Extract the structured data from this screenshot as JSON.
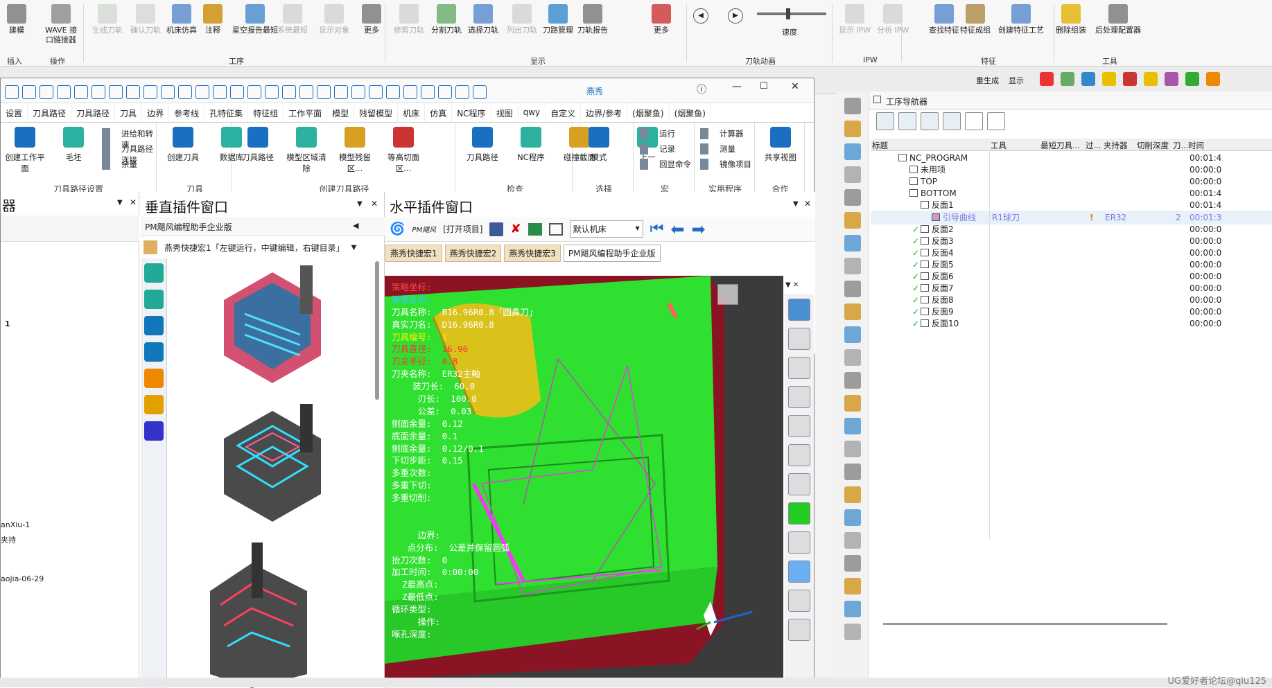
{
  "ribbon": {
    "buttons": [
      {
        "label": "建模",
        "icon": "modeling-icon"
      },
      {
        "label": "WAVE 接\n口链接器",
        "icon": "wave-link-icon"
      },
      {
        "label": "生成刀轨",
        "icon": "generate-path-icon",
        "disabled": true
      },
      {
        "label": "确认刀轨",
        "icon": "verify-path-icon",
        "disabled": true
      },
      {
        "label": "机床仿真",
        "icon": "machine-sim-icon"
      },
      {
        "label": "注释",
        "icon": "annotation-icon"
      },
      {
        "label": "星空报告最短",
        "icon": "report-icon"
      },
      {
        "label": "系统最短",
        "icon": "system-short-icon",
        "disabled": true
      },
      {
        "label": "显示对象",
        "icon": "show-object-icon",
        "disabled": true
      },
      {
        "label": "更多",
        "icon": "more-icon"
      },
      {
        "label": "修剪刀轨",
        "icon": "trim-path-icon",
        "disabled": true
      },
      {
        "label": "分割刀轨",
        "icon": "split-path-icon"
      },
      {
        "label": "选择刀轨",
        "icon": "select-path-icon"
      },
      {
        "label": "列出刀轨",
        "icon": "list-path-icon",
        "disabled": true
      },
      {
        "label": "刀路管理",
        "icon": "path-manage-icon"
      },
      {
        "label": "刀轨报告",
        "icon": "path-report-icon"
      },
      {
        "label": "更多",
        "icon": "more-icon"
      },
      {
        "label": "显示 IPW",
        "icon": "show-ipw-icon",
        "disabled": true
      },
      {
        "label": "分析 IPW",
        "icon": "analyze-ipw-icon",
        "disabled": true
      },
      {
        "label": "查找特征",
        "icon": "find-feature-icon"
      },
      {
        "label": "特征成组",
        "icon": "feature-group-icon"
      },
      {
        "label": "创建特征工艺",
        "icon": "feature-process-icon"
      },
      {
        "label": "删除组装",
        "icon": "delete-assembly-icon"
      },
      {
        "label": "后处理配置器",
        "icon": "postprocessor-icon"
      }
    ],
    "groups": [
      "插入",
      "操作",
      "工序",
      "显示",
      "刀轨动画",
      "IPW",
      "特征",
      "工具"
    ],
    "speed_label": "速度"
  },
  "subwin": {
    "title": "燕秀",
    "tabs": [
      "设置",
      "刀具路径",
      "刀具路径",
      "刀具",
      "边界",
      "参考线",
      "孔特征集",
      "特征组",
      "工作平面",
      "模型",
      "残留模型",
      "机床",
      "仿真",
      "NC程序",
      "视图",
      "qwy",
      "自定义",
      "边界/参考",
      "(烟聚鱼)",
      "(烟聚鱼)"
    ],
    "groups": [
      {
        "label": "刀具路径设置",
        "buttons": [
          "创建工作平面",
          "毛坯"
        ],
        "small": [
          "进给和转速",
          "刀具路径连接",
          "余量"
        ]
      },
      {
        "label": "刀具",
        "buttons": [
          "创建刀具",
          "数据库"
        ]
      },
      {
        "label": "创建刀具路径",
        "buttons": [
          "刀具路径",
          "模型区域清除",
          "模型残留区...",
          "等高切面区..."
        ]
      },
      {
        "label": "检查",
        "buttons": [
          "刀具路径",
          "NC程序",
          "碰撞截面"
        ]
      },
      {
        "label": "选择",
        "buttons": [
          "模式",
          "上一"
        ]
      },
      {
        "label": "宏",
        "small": [
          "运行",
          "记录",
          "回显命令"
        ]
      },
      {
        "label": "实用程序",
        "small": [
          "计算器",
          "测量",
          "镜像项目"
        ]
      },
      {
        "label": "合作",
        "buttons": [
          "共享视图"
        ]
      }
    ]
  },
  "left_pane": {
    "labels": [
      "1",
      "anXiu-1",
      "夹持",
      "aojia-06-29"
    ]
  },
  "vpane": {
    "title": "垂直插件窗口",
    "sub": "PM飓风编程助手企业版",
    "macro": "燕秀快捷宏1「左键运行，中键编辑，右键目录」"
  },
  "hpane": {
    "title": "水平插件窗口",
    "toolbar": {
      "logo": "PM飓风",
      "open": "[打开项目]",
      "machine": "默认机床"
    },
    "macros": [
      "燕秀快捷宏1",
      "燕秀快捷宏2",
      "燕秀快捷宏3"
    ],
    "active_tab": "PM飓风编程助手企业版"
  },
  "info_lines": [
    {
      "t": "策略坐标:",
      "c": "#ff4444"
    },
    {
      "t": "策略名称:",
      "c": "#33ccff"
    },
    {
      "t": "刀具名称:  B16.96R0.8「圆鼻刀」",
      "c": "#ffffff"
    },
    {
      "t": "真实刀名:  D16.96R0.8",
      "c": "#ffffff"
    },
    {
      "t": "刀具编号:  1",
      "c": "#ffee00"
    },
    {
      "t": "刀具直径:  16.96",
      "c": "#ff3333"
    },
    {
      "t": "刀尖半径:  0.8",
      "c": "#ff3333"
    },
    {
      "t": "刀夹名称:  ER32主軸",
      "c": "#ffffff"
    },
    {
      "t": "    装刀长:  60.0",
      "c": "#ffffff"
    },
    {
      "t": "     刃长:  100.0",
      "c": "#ffffff"
    },
    {
      "t": "     公差:  0.03",
      "c": "#ffffff"
    },
    {
      "t": "侧面余量:  0.12",
      "c": "#ffffff"
    },
    {
      "t": "底面余量:  0.1",
      "c": "#ffffff"
    },
    {
      "t": "侧底余量:  0.12/0.1",
      "c": "#ffffff"
    },
    {
      "t": "下切步距:  0.15",
      "c": "#ffffff"
    },
    {
      "t": "多重次数:",
      "c": "#ffffff"
    },
    {
      "t": "多重下切:",
      "c": "#ffffff"
    },
    {
      "t": "多重切削:",
      "c": "#ffffff"
    },
    {
      "t": "",
      "c": "#ffffff"
    },
    {
      "t": "",
      "c": "#ffffff"
    },
    {
      "t": "     边界:",
      "c": "#ffffff"
    },
    {
      "t": "   点分布:  公差并保留圆弧",
      "c": "#ffffff"
    },
    {
      "t": "抬刀次数:  0",
      "c": "#ffffff"
    },
    {
      "t": "加工时间:  0:00:00",
      "c": "#ffffff"
    },
    {
      "t": "  Z最高点:",
      "c": "#ffffff"
    },
    {
      "t": "  Z最低点:",
      "c": "#ffffff"
    },
    {
      "t": "循环类型:",
      "c": "#ffffff"
    },
    {
      "t": "     操作:",
      "c": "#ffffff"
    },
    {
      "t": "啄孔深度:",
      "c": "#ffffff"
    }
  ],
  "navigator": {
    "title": "工序导航器",
    "columns": [
      "标题",
      "工具",
      "最短刀具...",
      "过...",
      "夹持器",
      "切削深度",
      "刀...",
      "时间"
    ],
    "rows": [
      {
        "name": "NC_PROGRAM",
        "indent": 0,
        "time": "00:01:4"
      },
      {
        "name": "未用项",
        "indent": 1,
        "time": "00:00:0"
      },
      {
        "name": "TOP",
        "indent": 1,
        "time": "00:00:0"
      },
      {
        "name": "BOTTOM",
        "indent": 1,
        "time": "00:01:4"
      },
      {
        "name": "反面1",
        "indent": 2,
        "time": "00:01:4"
      },
      {
        "name": "引导曲线",
        "indent": 3,
        "tool": "R1球刀",
        "warn": "!",
        "holder": "ER32",
        "num": "2",
        "time": "00:01:3"
      },
      {
        "name": "反面2",
        "indent": 2,
        "check": true,
        "time": "00:00:0"
      },
      {
        "name": "反面3",
        "indent": 2,
        "check": true,
        "time": "00:00:0"
      },
      {
        "name": "反面4",
        "indent": 2,
        "check": true,
        "time": "00:00:0"
      },
      {
        "name": "反面5",
        "indent": 2,
        "check": true,
        "time": "00:00:0"
      },
      {
        "name": "反面6",
        "indent": 2,
        "check": true,
        "time": "00:00:0"
      },
      {
        "name": "反面7",
        "indent": 2,
        "check": true,
        "time": "00:00:0"
      },
      {
        "name": "反面8",
        "indent": 2,
        "check": true,
        "time": "00:00:0"
      },
      {
        "name": "反面9",
        "indent": 2,
        "check": true,
        "time": "00:00:0"
      },
      {
        "name": "反面10",
        "indent": 2,
        "check": true,
        "time": "00:00:0"
      }
    ]
  },
  "misc": {
    "watermark": "UG爱好者论坛@qiu125",
    "quick_items": [
      "重生成",
      "显示"
    ]
  },
  "colors": {
    "model_green": "#2fe12f",
    "model_red": "#a01a28",
    "tool_yellow": "#d9c21a",
    "accent_blue": "#1a6fc0"
  }
}
